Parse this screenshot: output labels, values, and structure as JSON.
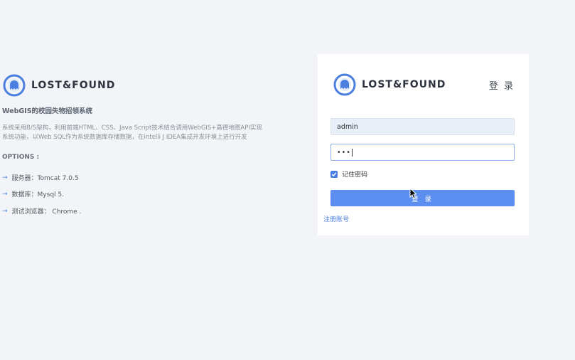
{
  "info": {
    "brand": "LOST&FOUND",
    "app_title": "WebGIS的校园失物招领系统",
    "description": "系统采用B/S架构，利用前端HTML、CSS、Java Script技术结合调用WebGIS+高德地图API实现系统功能，以Web SQL作为系统数据库存储数据，在intelli J IDEA集成开发环境上进行开发",
    "options_title": "OPTIONS :",
    "options": [
      {
        "label": "服务器：Tomcat 7.0.5"
      },
      {
        "label": "数据库：Mysql 5."
      },
      {
        "label": "测试浏览器： Chrome ."
      }
    ],
    "icon": "logo-icon"
  },
  "login": {
    "brand": "LOST&FOUND",
    "title": "登 录",
    "username_value": "admin",
    "password_value": "•••",
    "remember_label": "记住密码",
    "remember_checked": true,
    "submit_label": "登 录",
    "register_link": "注册账号"
  },
  "colors": {
    "accent": "#4a7fe0",
    "button": "#5b8ef0",
    "background": "#f2f4f7",
    "card": "#ffffff"
  }
}
